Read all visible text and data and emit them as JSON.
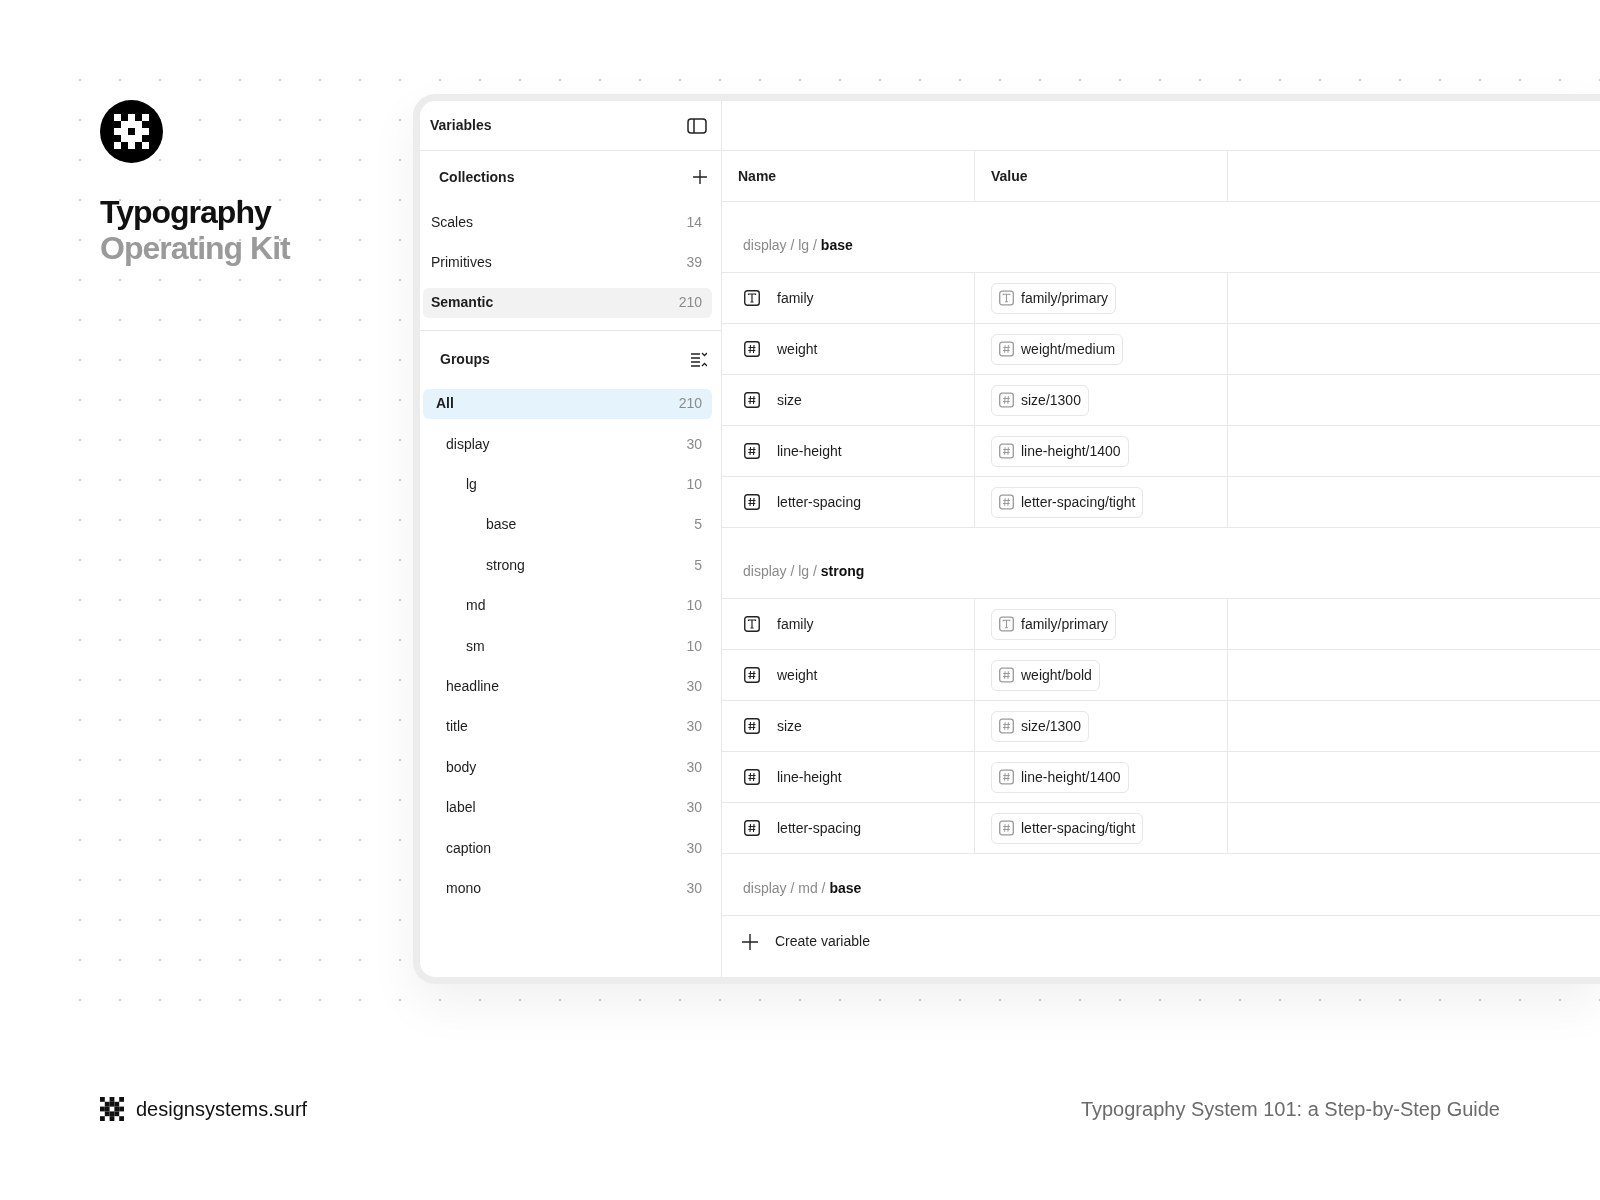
{
  "brand": {
    "title": "Typography",
    "subtitle": "Operating Kit"
  },
  "sidebar": {
    "title": "Variables",
    "collections": {
      "heading": "Collections",
      "items": [
        {
          "label": "Scales",
          "count": "14",
          "selected": false
        },
        {
          "label": "Primitives",
          "count": "39",
          "selected": false
        },
        {
          "label": "Semantic",
          "count": "210",
          "selected": true
        }
      ]
    },
    "groups": {
      "heading": "Groups",
      "items": [
        {
          "label": "All",
          "count": "210",
          "selected": true,
          "children": [
            {
              "label": "display",
              "count": "30",
              "selected": false,
              "children": [
                {
                  "label": "lg",
                  "count": "10",
                  "selected": false,
                  "children": [
                    {
                      "label": "base",
                      "count": "5",
                      "selected": false
                    },
                    {
                      "label": "strong",
                      "count": "5",
                      "selected": false
                    }
                  ]
                },
                {
                  "label": "md",
                  "count": "10",
                  "selected": false
                },
                {
                  "label": "sm",
                  "count": "10",
                  "selected": false
                }
              ]
            },
            {
              "label": "headline",
              "count": "30",
              "selected": false
            },
            {
              "label": "title",
              "count": "30",
              "selected": false
            },
            {
              "label": "body",
              "count": "30",
              "selected": false
            },
            {
              "label": "label",
              "count": "30",
              "selected": false
            },
            {
              "label": "caption",
              "count": "30",
              "selected": false
            },
            {
              "label": "mono",
              "count": "30",
              "selected": false
            }
          ]
        }
      ]
    }
  },
  "table": {
    "columns": [
      "Name",
      "Value"
    ],
    "sections": [
      {
        "path": "display / lg / **base**",
        "rows": [
          {
            "kind": "text",
            "name": "family",
            "value": "family/primary"
          },
          {
            "kind": "number",
            "name": "weight",
            "value": "weight/medium"
          },
          {
            "kind": "number",
            "name": "size",
            "value": "size/1300"
          },
          {
            "kind": "number",
            "name": "line-height",
            "value": "line-height/1400"
          },
          {
            "kind": "number",
            "name": "letter-spacing",
            "value": "letter-spacing/tight"
          }
        ]
      },
      {
        "path": "display / lg / **strong**",
        "rows": [
          {
            "kind": "text",
            "name": "family",
            "value": "family/primary"
          },
          {
            "kind": "number",
            "name": "weight",
            "value": "weight/bold"
          },
          {
            "kind": "number",
            "name": "size",
            "value": "size/1300"
          },
          {
            "kind": "number",
            "name": "line-height",
            "value": "line-height/1400"
          },
          {
            "kind": "number",
            "name": "letter-spacing",
            "value": "letter-spacing/tight"
          }
        ]
      },
      {
        "path": "display / md / **base**"
      }
    ],
    "create": "Create variable"
  },
  "footer": {
    "site": "designsystems.surf",
    "caption": "Typography System 101: a Step-by-Step Guide"
  }
}
